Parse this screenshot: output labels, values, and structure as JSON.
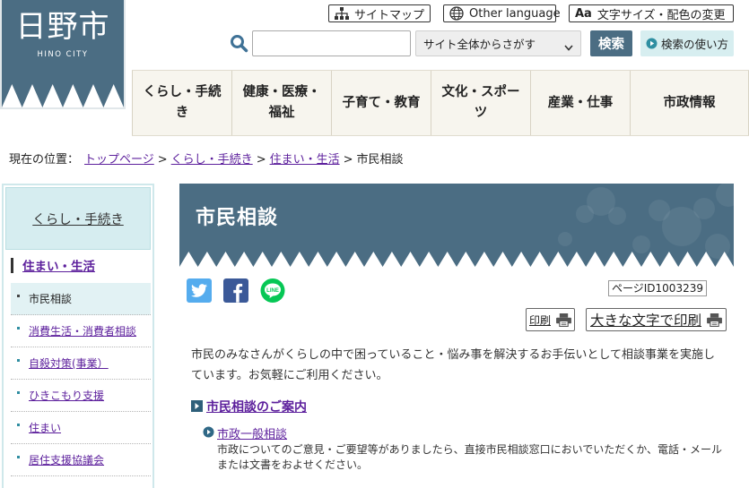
{
  "logo": {
    "title": "日野市",
    "subtitle": "HINO CITY"
  },
  "utility": {
    "sitemap_icon": "sitemap-icon",
    "sitemap_label": "サイトマップ",
    "language_icon": "globe-icon",
    "language_label": "Other language",
    "text_size_icon_text": "Aa",
    "text_size_label": "文字サイズ・配色の変更"
  },
  "search": {
    "icon": "search-icon",
    "value": "",
    "placeholder": "",
    "scope_selected": "サイト全体からさがす",
    "button_label": "検索",
    "help_icon": "play-circle-icon",
    "help_label": "検索の使い方"
  },
  "nav": [
    {
      "label": "くらし・手続き"
    },
    {
      "label": "健康・医療・福祉"
    },
    {
      "label": "子育て・教育"
    },
    {
      "label": "文化・スポーツ"
    },
    {
      "label": "産業・仕事"
    },
    {
      "label": "市政情報"
    }
  ],
  "breadcrumb": {
    "prefix": "現在の位置：",
    "links": [
      "トップページ",
      "くらし・手続き",
      "住まい・生活"
    ],
    "separator": ">",
    "current": "市民相談"
  },
  "sidebar": {
    "heading": "くらし・手続き",
    "section": "住まい・生活",
    "items": [
      {
        "label": "市民相談",
        "current": true
      },
      {
        "label": "消費生活・消費者相談",
        "current": false
      },
      {
        "label": "自殺対策(事業）",
        "current": false
      },
      {
        "label": "ひきこもり支援",
        "current": false
      },
      {
        "label": "住まい",
        "current": false
      },
      {
        "label": "居住支援協議会",
        "current": false
      }
    ]
  },
  "page": {
    "title": "市民相談",
    "share": [
      {
        "icon": "twitter-icon"
      },
      {
        "icon": "facebook-icon"
      },
      {
        "icon": "line-icon",
        "logo_text": "LINE"
      }
    ],
    "page_id": "ページID1003239",
    "print_label": "印刷",
    "print_large_label": "大きな文字で印刷",
    "print_icon": "printer-icon",
    "intro": "市民のみなさんがくらしの中で困っていること・悩み事を解決するお手伝いとして相談事業を実施しています。お気軽にご利用ください。",
    "section_heading": "市民相談のご案内",
    "sub_heading": "市政一般相談",
    "sub_text": "市政についてのご意見・ご要望等がありましたら、直接市民相談窓口においでいただくか、電話・メールまたは文書をおよせください。"
  },
  "colors": {
    "brand": "#4b6d83",
    "link": "#5c1f9c",
    "nav_background": "#f7f5ee",
    "accent_light": "#d6edf0",
    "twitter": "#55acee",
    "facebook": "#3b5998",
    "line": "#06c755"
  }
}
